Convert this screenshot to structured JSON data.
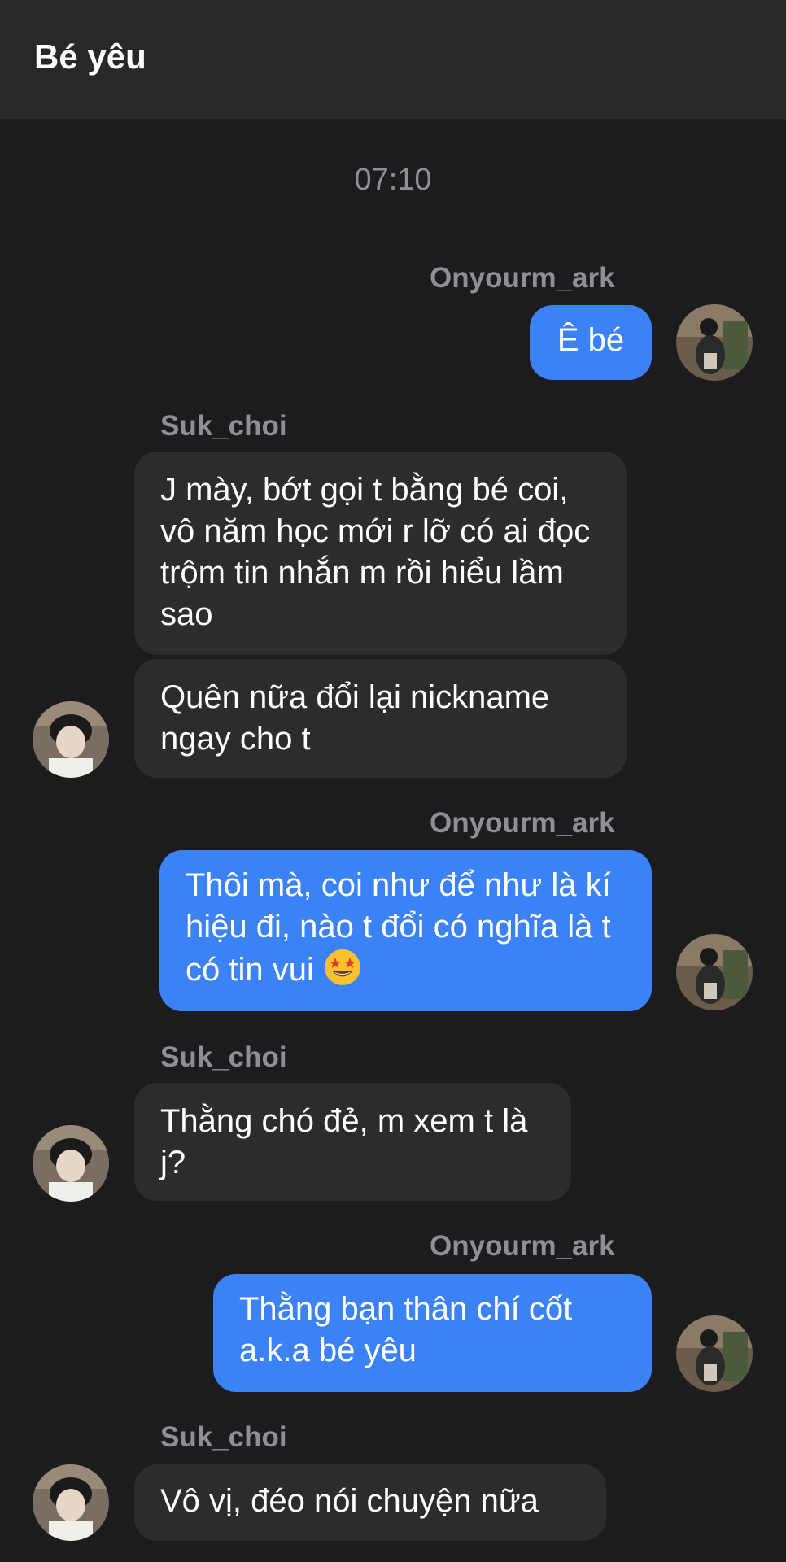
{
  "header": {
    "title": "Bé yêu"
  },
  "timestamp": "07:10",
  "messages": [
    {
      "sender": "Onyourm_ark",
      "direction": "out",
      "text": "Ê bé"
    },
    {
      "sender": "Suk_choi",
      "direction": "in",
      "text": "J mày, bớt gọi t bằng bé coi, vô năm học mới r lỡ có ai đọc trộm tin nhắn m rồi hiểu lầm sao"
    },
    {
      "direction": "in",
      "text": "Quên nữa đổi lại nickname ngay cho t"
    },
    {
      "sender": "Onyourm_ark",
      "direction": "out",
      "text": "Thôi mà, coi như để như là kí hiệu đi, nào t đổi có nghĩa là t có tin vui",
      "emoji": "star-struck-emoji"
    },
    {
      "sender": "Suk_choi",
      "direction": "in",
      "text": "Thằng chó đẻ, m xem t là j?"
    },
    {
      "sender": "Onyourm_ark",
      "direction": "out",
      "text": "Thằng bạn thân chí cốt a.k.a bé yêu"
    },
    {
      "sender": "Suk_choi",
      "direction": "in",
      "text": "Vô vị, đéo nói chuyện nữa"
    }
  ],
  "colors": {
    "background": "#1c1c1e",
    "header": "#28282a",
    "outgoing_bubble": "#3b82f6",
    "incoming_bubble": "#2c2c2e",
    "meta_text": "#8e8e93"
  }
}
